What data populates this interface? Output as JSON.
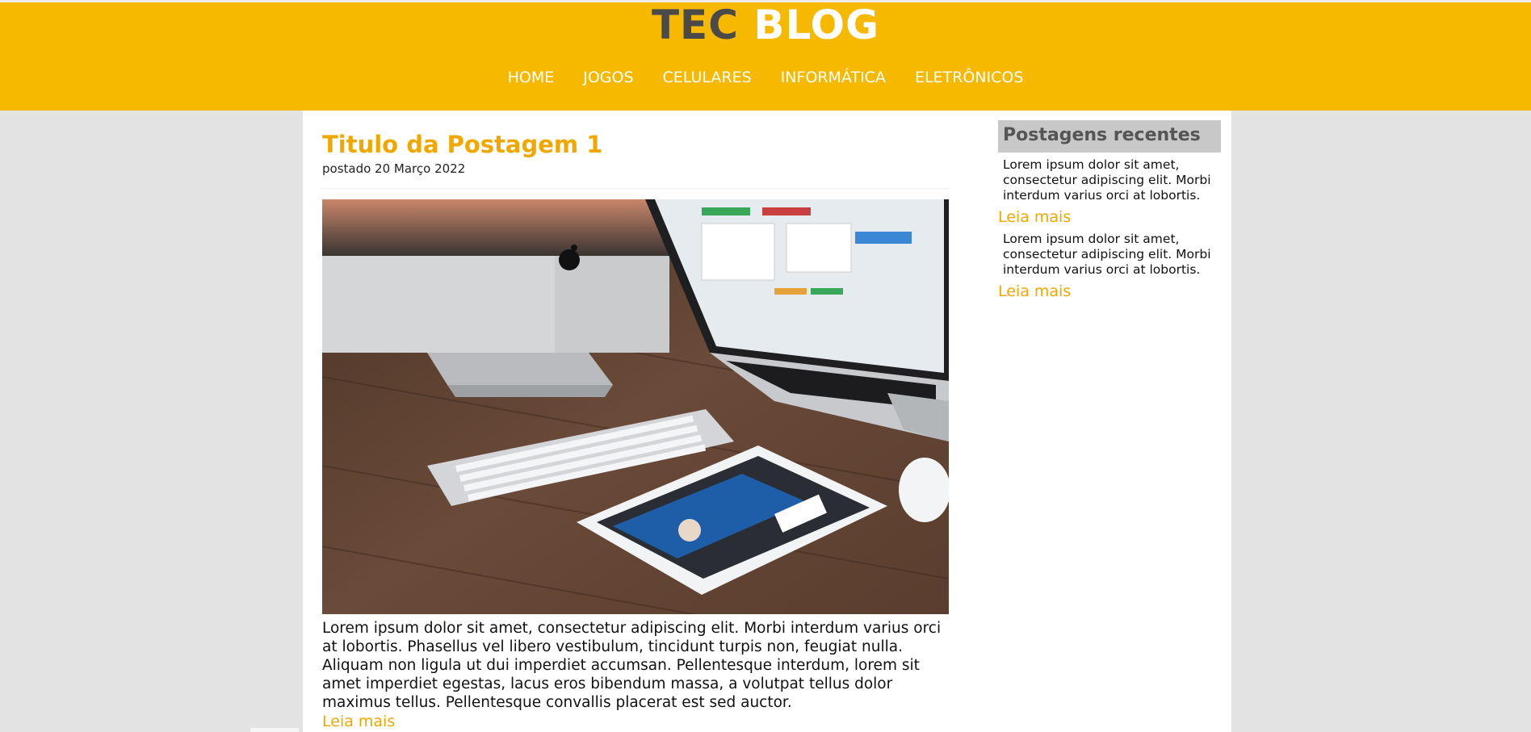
{
  "header": {
    "logo_part1": "TEC",
    "logo_part2": "BLOG",
    "nav": [
      "HOME",
      "JOGOS",
      "CELULARES",
      "INFORMÁTICA",
      "ELETRÔNICOS"
    ]
  },
  "post": {
    "title": "Titulo da Postagem 1",
    "date": "postado 20 Março 2022",
    "body": "Lorem ipsum dolor sit amet, consectetur adipiscing elit. Morbi interdum varius orci at lobortis. Phasellus vel libero vestibulum, tincidunt turpis non, feugiat nulla. Aliquam non ligula ut dui imperdiet accumsan. Pellentesque interdum, lorem sit amet imperdiet egestas, lacus eros bibendum massa, a volutpat tellus dolor maximus tellus. Pellentesque convallis placerat est sed auctor.",
    "read_more": "Leia mais"
  },
  "sidebar": {
    "title": "Postagens recentes",
    "items": [
      {
        "text": "Lorem ipsum dolor sit amet, consectetur adipiscing elit. Morbi interdum varius orci at lobortis.",
        "read_more": "Leia mais"
      },
      {
        "text": "Lorem ipsum dolor sit amet, consectetur adipiscing elit. Morbi interdum varius orci at lobortis.",
        "read_more": "Leia mais"
      }
    ]
  },
  "colors": {
    "accent": "#f7b800",
    "link": "#f0a800",
    "page_background": "#e3e3e3",
    "sidebar_title_bg": "#c8c8c8"
  }
}
